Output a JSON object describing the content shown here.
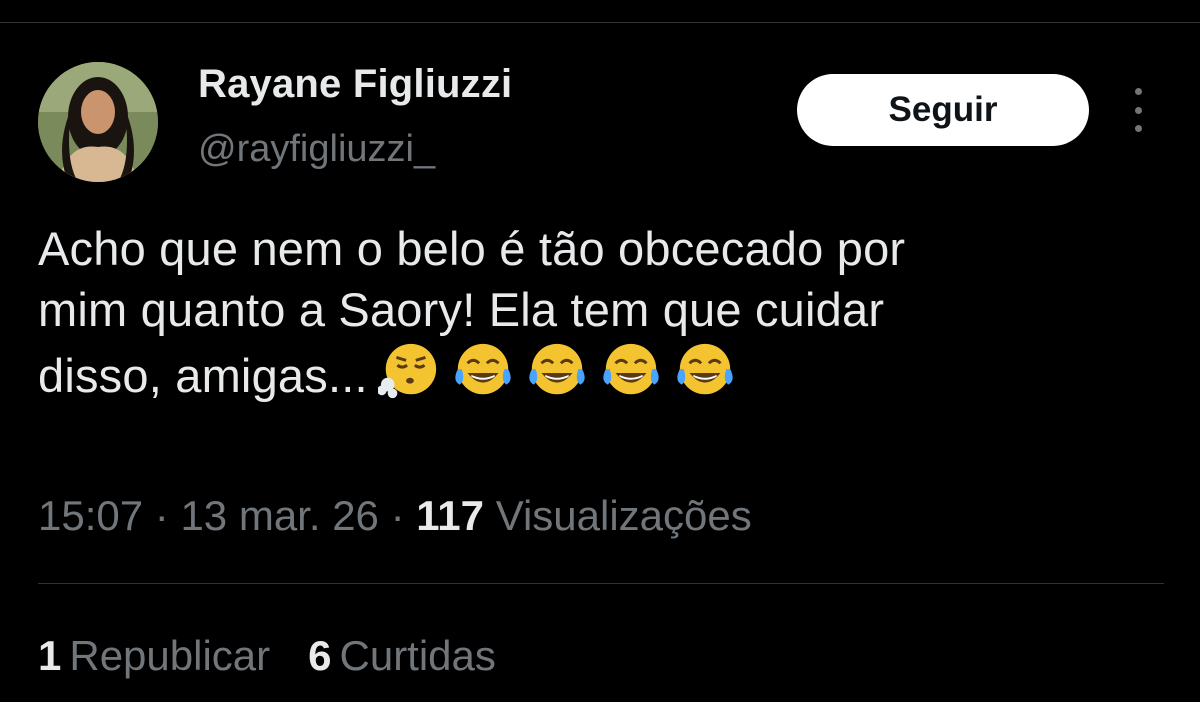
{
  "author": {
    "display_name": "Rayane Figliuzzi",
    "handle": "@rayfigliuzzi_"
  },
  "actions": {
    "follow_label": "Seguir",
    "more_icon": "more-vertical-icon"
  },
  "tweet": {
    "lines": [
      "Acho que nem o belo é tão obcecado por",
      "mim quanto a Saory! Ela tem que cuidar",
      "disso, amigas..."
    ],
    "emojis": [
      "face-exhaling-emoji",
      "tears-of-joy-emoji",
      "tears-of-joy-emoji",
      "tears-of-joy-emoji",
      "tears-of-joy-emoji"
    ]
  },
  "meta": {
    "time": "15:07",
    "separator": "·",
    "date": "13 mar. 26",
    "views_count": "117",
    "views_label": "Visualizações"
  },
  "stats": {
    "reposts_count": "1",
    "reposts_label": "Republicar",
    "likes_count": "6",
    "likes_label": "Curtidas"
  },
  "colors": {
    "background": "#000000",
    "primary_text": "#e7e9ea",
    "secondary_text": "#71767b",
    "divider": "#2f3336",
    "button_bg": "#ffffff"
  }
}
